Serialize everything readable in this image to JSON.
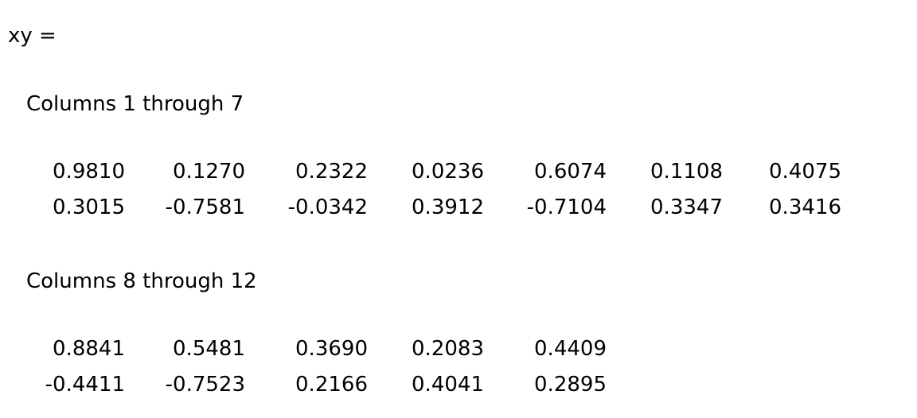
{
  "console": {
    "variable_line": "xy =",
    "blocks": [
      {
        "header": "Columns 1 through 7",
        "rows": [
          [
            "0.9810",
            "0.1270",
            "0.2322",
            "0.0236",
            "0.6074",
            "0.1108",
            "0.4075"
          ],
          [
            "0.3015",
            "-0.7581",
            "-0.0342",
            "0.3912",
            "-0.7104",
            "0.3347",
            "0.3416"
          ]
        ]
      },
      {
        "header": "Columns 8 through 12",
        "rows": [
          [
            "0.8841",
            "0.5481",
            "0.3690",
            "0.2083",
            "0.4409"
          ],
          [
            "-0.4411",
            "-0.7523",
            "0.2166",
            "0.4041",
            "0.2895"
          ]
        ]
      }
    ]
  }
}
